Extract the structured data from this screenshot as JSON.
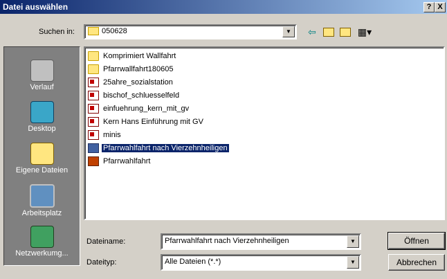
{
  "window": {
    "title": "Datei auswählen",
    "help_label": "?",
    "close_label": "X"
  },
  "toolbar": {
    "lookin_label": "Suchen in:",
    "lookin_value": "050628",
    "back_icon": "back-arrow-icon",
    "up_icon": "up-folder-icon",
    "new_folder_icon": "new-folder-icon",
    "view_icon": "view-menu-icon"
  },
  "places": [
    {
      "label": "Verlauf",
      "icon": "history-icon"
    },
    {
      "label": "Desktop",
      "icon": "desktop-icon"
    },
    {
      "label": "Eigene Dateien",
      "icon": "my-documents-icon"
    },
    {
      "label": "Arbeitsplatz",
      "icon": "my-computer-icon"
    },
    {
      "label": "Netzwerkumg...",
      "icon": "network-icon"
    }
  ],
  "files": [
    {
      "name": "Komprimiert Wallfahrt",
      "type": "folder"
    },
    {
      "name": "Pfarrwallfahrt180605",
      "type": "folder"
    },
    {
      "name": "25ahre_sozialstation",
      "type": "publisher"
    },
    {
      "name": "bischof_schluesselfeld",
      "type": "publisher"
    },
    {
      "name": "einfuehrung_kern_mit_gv",
      "type": "publisher"
    },
    {
      "name": "Kern Hans Einführung mit GV",
      "type": "publisher"
    },
    {
      "name": "minis",
      "type": "publisher"
    },
    {
      "name": "Pfarrwahlfahrt nach Vierzehnheiligen",
      "type": "presentation",
      "selected": true
    },
    {
      "name": "Pfarrwahlfahrt",
      "type": "powerpoint"
    }
  ],
  "filename": {
    "label": "Dateiname:",
    "value": "Pfarrwahlfahrt nach Vierzehnheiligen"
  },
  "filetype": {
    "label": "Dateityp:",
    "value": "Alle Dateien (*.*)"
  },
  "buttons": {
    "open": "Öffnen",
    "cancel": "Abbrechen"
  }
}
